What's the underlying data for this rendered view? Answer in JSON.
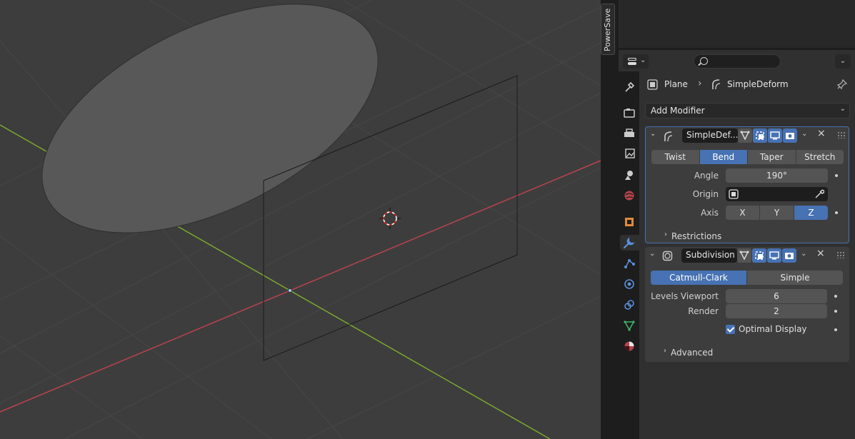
{
  "n_panel": {
    "tab_label": "PowerSave"
  },
  "header": {
    "search": {
      "value": "",
      "placeholder": ""
    }
  },
  "breadcrumb": {
    "object": "Plane",
    "modifier": "SimpleDeform"
  },
  "add_modifier": {
    "label": "Add Modifier"
  },
  "modifiers": [
    {
      "name": "SimpleDef...",
      "deform_modes": [
        "Twist",
        "Bend",
        "Taper",
        "Stretch"
      ],
      "selected_mode": "Bend",
      "angle": {
        "label": "Angle",
        "value": "190°"
      },
      "origin": {
        "label": "Origin",
        "value": ""
      },
      "axis": {
        "label": "Axis",
        "options": [
          "X",
          "Y",
          "Z"
        ],
        "selected": "Z"
      },
      "restrictions": {
        "label": "Restrictions"
      }
    },
    {
      "name": "Subdivision",
      "algorithms": [
        "Catmull-Clark",
        "Simple"
      ],
      "selected_algorithm": "Catmull-Clark",
      "levels_viewport": {
        "label": "Levels Viewport",
        "value": "6"
      },
      "render": {
        "label": "Render",
        "value": "2"
      },
      "optimal_display": {
        "label": "Optimal Display",
        "checked": true
      },
      "advanced": {
        "label": "Advanced"
      }
    }
  ],
  "colors": {
    "accent": "#4772b3",
    "viewport_bg": "#3d3d3d",
    "x_axis": "#b8434d",
    "y_axis": "#7aa72e"
  }
}
